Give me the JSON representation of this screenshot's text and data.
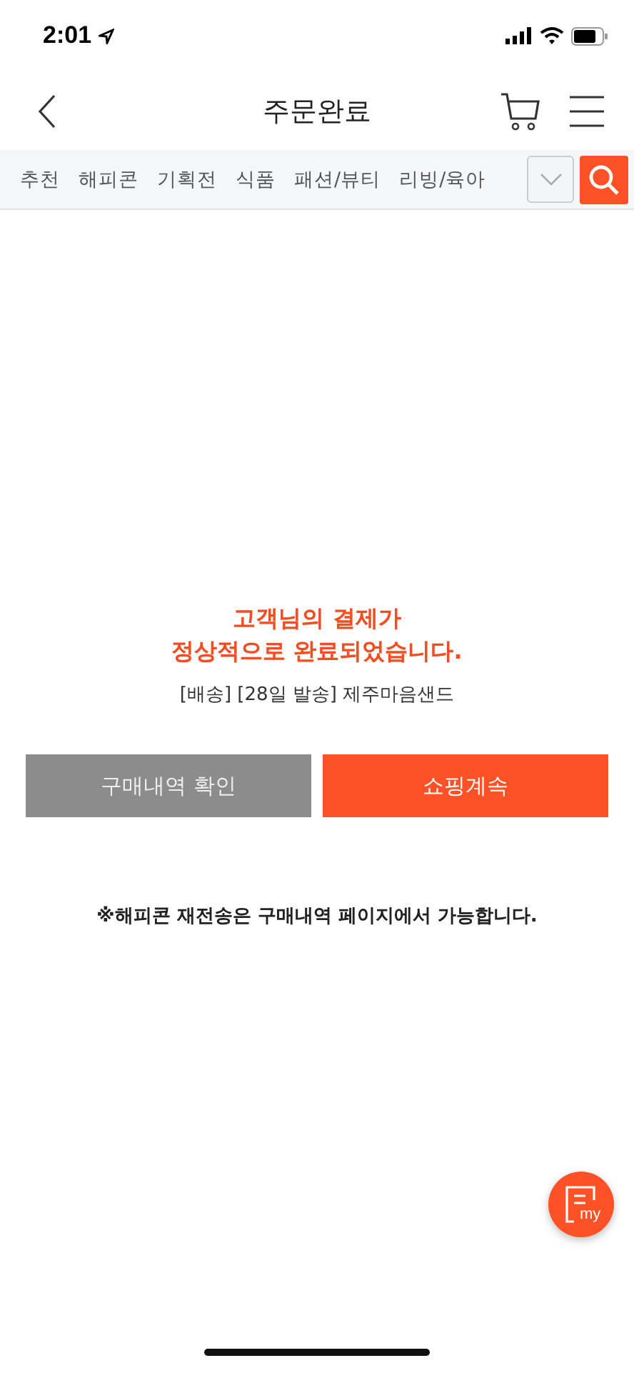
{
  "status_bar": {
    "time": "2:01"
  },
  "header": {
    "title": "주문완료"
  },
  "categories": [
    {
      "label": "추천"
    },
    {
      "label": "해피콘"
    },
    {
      "label": "기획전"
    },
    {
      "label": "식품"
    },
    {
      "label": "패션/뷰티"
    },
    {
      "label": "리빙/육아"
    }
  ],
  "message": {
    "headline": [
      "고객님의 결제가",
      "정상적으로 완료되었습니다."
    ],
    "product": "[배송] [28일 발송] 제주마음샌드"
  },
  "buttons": [
    {
      "label": "구매내역 확인",
      "kind": "secondary"
    },
    {
      "label": "쇼핑계속",
      "kind": "primary"
    }
  ],
  "notice": "※해피콘 재전송은 구매내역 페이지에서 가능합니다.",
  "fab": {
    "label": "my"
  }
}
